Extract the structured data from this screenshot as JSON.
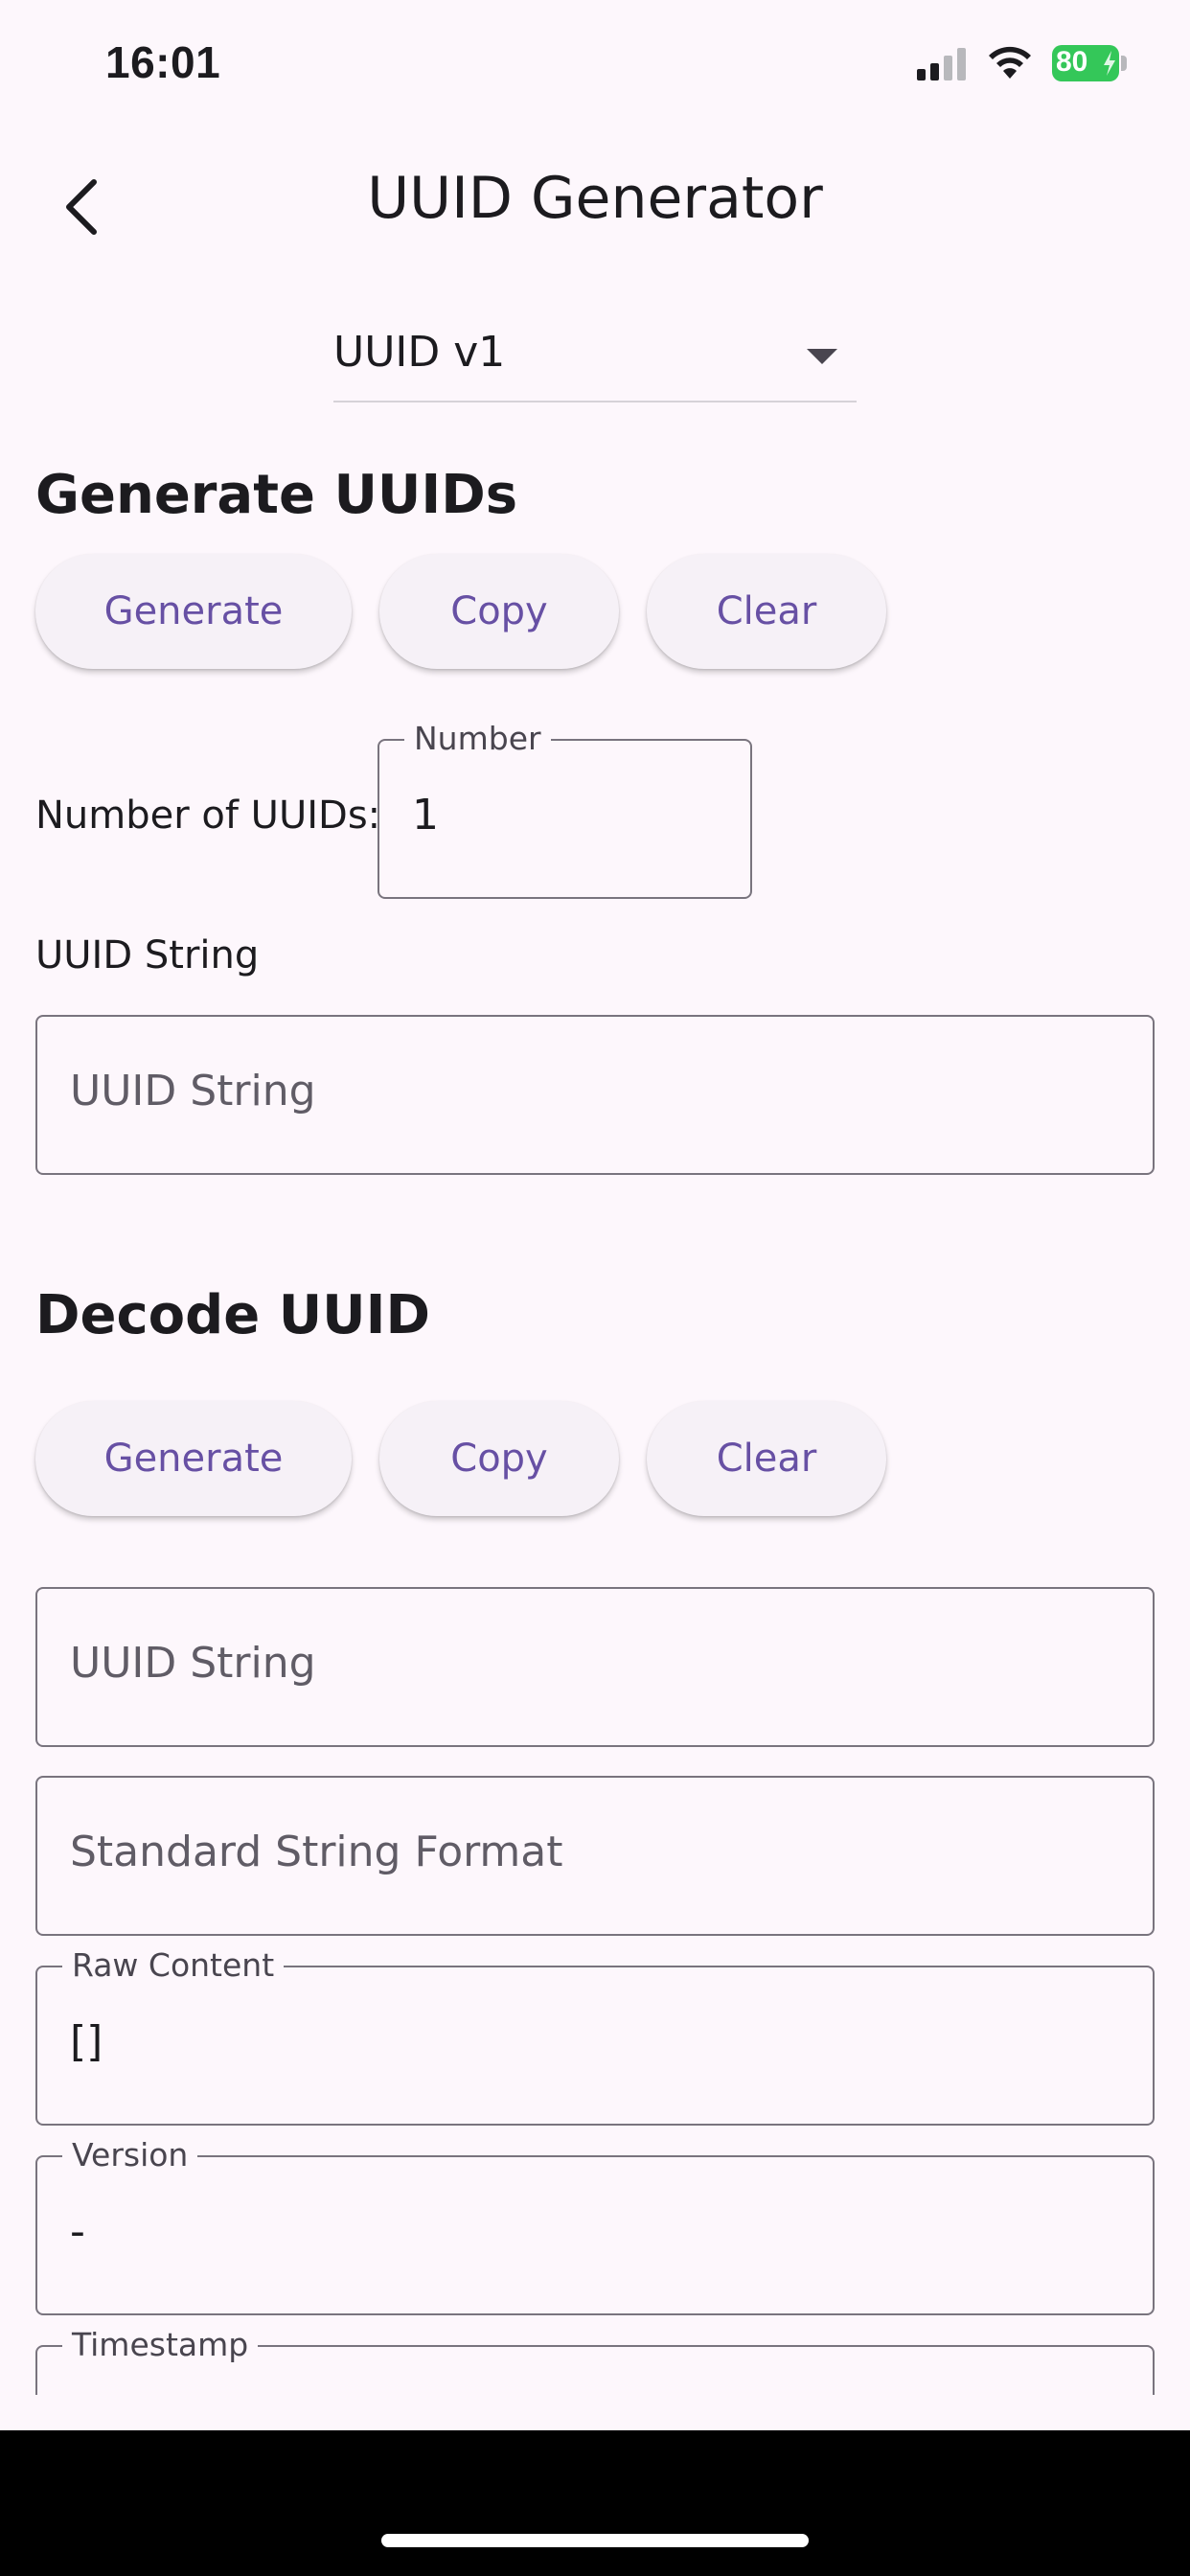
{
  "status_bar": {
    "time": "16:01",
    "battery": "80"
  },
  "app_bar": {
    "title": "UUID Generator",
    "back_icon": "chevron-left-icon"
  },
  "version_dropdown": {
    "selected": "UUID v1"
  },
  "generate_section": {
    "title": "Generate UUIDs",
    "buttons": [
      "Generate",
      "Copy",
      "Clear"
    ],
    "number_row_label": "Number of UUIDs:",
    "number_field": {
      "label": "Number",
      "value": "1"
    },
    "uuid_string_label": "UUID String",
    "uuid_string_field": {
      "placeholder": "UUID String"
    }
  },
  "decode_section": {
    "title": "Decode UUID",
    "buttons": [
      "Generate",
      "Copy",
      "Clear"
    ],
    "uuid_string_field": {
      "placeholder": "UUID String"
    },
    "standard_format_field": {
      "placeholder": "Standard String Format"
    },
    "raw_content_field": {
      "label": "Raw Content",
      "value": "[]"
    },
    "version_field": {
      "label": "Version",
      "value": "-"
    },
    "timestamp_field": {
      "label": "Timestamp"
    }
  },
  "colors": {
    "background": "#FDF7FC",
    "accent": "#6750A4",
    "outline": "#79747E",
    "battery": "#34C759"
  }
}
